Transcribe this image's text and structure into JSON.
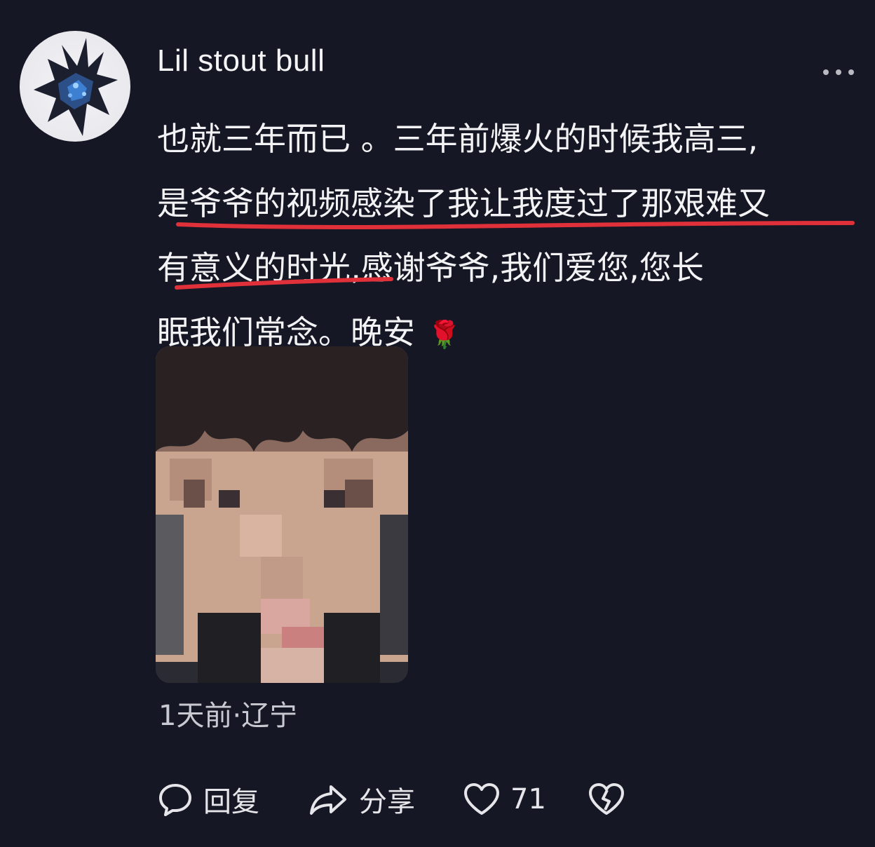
{
  "user": {
    "name": "Lil stout bull",
    "avatar_icon": "spiky-crystal-avatar-icon"
  },
  "menu": {
    "icon": "more-dots-icon"
  },
  "comment": {
    "lines": [
      "也就三年而已 。三年前爆火的时候我高三,",
      "是爷爷的视频感染了我让我度过了那艰难又",
      "有意义的时光,感谢爷爷,我们爱您,您长",
      "眠我们常念。晚安"
    ],
    "emoji_icon": "rose-icon",
    "emoji": "🌹",
    "underline_color": "#e0313a"
  },
  "photo": {
    "alt_icon": "pixelated-face-photo"
  },
  "meta": {
    "time": "1天前",
    "separator": "·",
    "location": "辽宁"
  },
  "actions": {
    "reply": {
      "label": "回复",
      "icon": "comment-bubble-icon"
    },
    "share": {
      "label": "分享",
      "icon": "share-arrow-icon"
    },
    "like": {
      "count": "71",
      "icon": "heart-icon"
    },
    "dislike": {
      "icon": "broken-heart-icon"
    }
  }
}
